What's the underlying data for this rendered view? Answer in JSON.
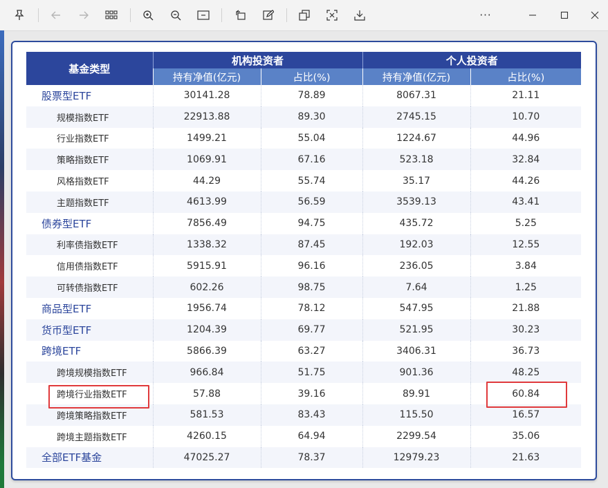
{
  "toolbar": {
    "icons": [
      "pin-icon",
      "back-icon",
      "forward-icon",
      "grid-icon",
      "zoom-in-icon",
      "zoom-out-icon",
      "fit-icon",
      "rotate-icon",
      "edit-icon",
      "copy-icon",
      "crop-icon",
      "save-icon",
      "more-icon",
      "minimize-icon",
      "maximize-icon",
      "close-icon"
    ],
    "more_label": "···"
  },
  "table": {
    "header": {
      "category": "基金类型",
      "institutional": "机构投资者",
      "individual": "个人投资者",
      "nav": "持有净值(亿元)",
      "pct": "占比(%)"
    },
    "rows": [
      {
        "name": "股票型ETF",
        "level": "main",
        "inst_nav": "30141.28",
        "inst_pct": "78.89",
        "ind_nav": "8067.31",
        "ind_pct": "21.11"
      },
      {
        "name": "规模指数ETF",
        "level": "sub",
        "inst_nav": "22913.88",
        "inst_pct": "89.30",
        "ind_nav": "2745.15",
        "ind_pct": "10.70"
      },
      {
        "name": "行业指数ETF",
        "level": "sub",
        "inst_nav": "1499.21",
        "inst_pct": "55.04",
        "ind_nav": "1224.67",
        "ind_pct": "44.96"
      },
      {
        "name": "策略指数ETF",
        "level": "sub",
        "inst_nav": "1069.91",
        "inst_pct": "67.16",
        "ind_nav": "523.18",
        "ind_pct": "32.84"
      },
      {
        "name": "风格指数ETF",
        "level": "sub",
        "inst_nav": "44.29",
        "inst_pct": "55.74",
        "ind_nav": "35.17",
        "ind_pct": "44.26"
      },
      {
        "name": "主题指数ETF",
        "level": "sub",
        "inst_nav": "4613.99",
        "inst_pct": "56.59",
        "ind_nav": "3539.13",
        "ind_pct": "43.41"
      },
      {
        "name": "债券型ETF",
        "level": "main",
        "inst_nav": "7856.49",
        "inst_pct": "94.75",
        "ind_nav": "435.72",
        "ind_pct": "5.25"
      },
      {
        "name": "利率债指数ETF",
        "level": "sub",
        "inst_nav": "1338.32",
        "inst_pct": "87.45",
        "ind_nav": "192.03",
        "ind_pct": "12.55"
      },
      {
        "name": "信用债指数ETF",
        "level": "sub",
        "inst_nav": "5915.91",
        "inst_pct": "96.16",
        "ind_nav": "236.05",
        "ind_pct": "3.84"
      },
      {
        "name": "可转债指数ETF",
        "level": "sub",
        "inst_nav": "602.26",
        "inst_pct": "98.75",
        "ind_nav": "7.64",
        "ind_pct": "1.25"
      },
      {
        "name": "商品型ETF",
        "level": "main",
        "inst_nav": "1956.74",
        "inst_pct": "78.12",
        "ind_nav": "547.95",
        "ind_pct": "21.88"
      },
      {
        "name": "货币型ETF",
        "level": "main",
        "inst_nav": "1204.39",
        "inst_pct": "69.77",
        "ind_nav": "521.95",
        "ind_pct": "30.23"
      },
      {
        "name": "跨境ETF",
        "level": "main",
        "inst_nav": "5866.39",
        "inst_pct": "63.27",
        "ind_nav": "3406.31",
        "ind_pct": "36.73"
      },
      {
        "name": "跨境规模指数ETF",
        "level": "sub",
        "inst_nav": "966.84",
        "inst_pct": "51.75",
        "ind_nav": "901.36",
        "ind_pct": "48.25"
      },
      {
        "name": "跨境行业指数ETF",
        "level": "sub",
        "inst_nav": "57.88",
        "inst_pct": "39.16",
        "ind_nav": "89.91",
        "ind_pct": "60.84"
      },
      {
        "name": "跨境策略指数ETF",
        "level": "sub",
        "inst_nav": "581.53",
        "inst_pct": "83.43",
        "ind_nav": "115.50",
        "ind_pct": "16.57"
      },
      {
        "name": "跨境主题指数ETF",
        "level": "sub",
        "inst_nav": "4260.15",
        "inst_pct": "64.94",
        "ind_nav": "2299.54",
        "ind_pct": "35.06"
      },
      {
        "name": "全部ETF基金",
        "level": "main",
        "inst_nav": "47025.27",
        "inst_pct": "78.37",
        "ind_nav": "12979.23",
        "ind_pct": "21.63"
      }
    ]
  },
  "highlight_color": "#e0393b"
}
